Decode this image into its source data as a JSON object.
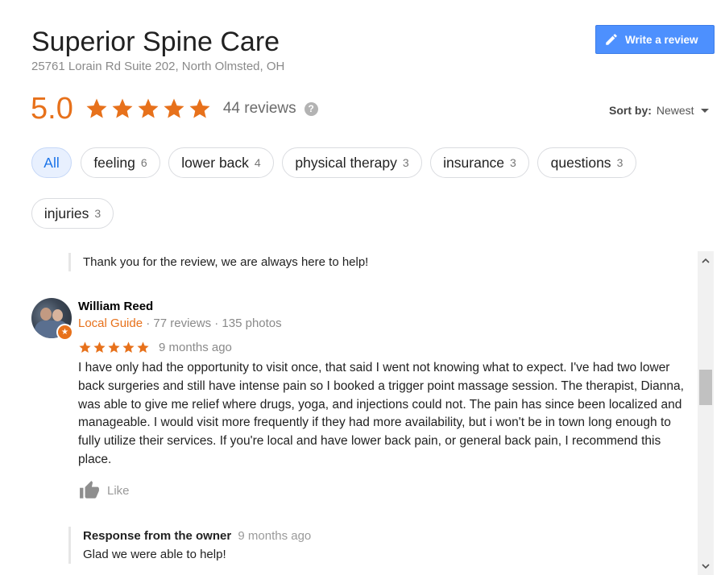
{
  "business": {
    "name": "Superior Spine Care",
    "address": "25761 Lorain Rd Suite 202, North Olmsted, OH"
  },
  "write_review": {
    "label": "Write a review",
    "icon": "pencil-icon"
  },
  "rating": {
    "score": "5.0",
    "stars": 5,
    "reviews_label": "44 reviews",
    "help_symbol": "?"
  },
  "sort": {
    "label": "Sort by:",
    "value": "Newest"
  },
  "topics": [
    {
      "label": "All",
      "count": ""
    },
    {
      "label": "feeling",
      "count": "6"
    },
    {
      "label": "lower back",
      "count": "4"
    },
    {
      "label": "physical therapy",
      "count": "3"
    },
    {
      "label": "insurance",
      "count": "3"
    },
    {
      "label": "questions",
      "count": "3"
    },
    {
      "label": "injuries",
      "count": "3"
    }
  ],
  "prev_owner_reply": {
    "text": "Thank you for the review, we are always here to help!"
  },
  "review": {
    "author": "William Reed",
    "local_guide": "Local Guide",
    "meta": " · 77 reviews · 135 photos",
    "stars": 5,
    "time": "9 months ago",
    "text": "I have only had the opportunity to visit once, that said I went not knowing what to expect. I've had two lower back surgeries and still have intense pain so I booked a trigger point massage session. The therapist, Dianna, was able to give me relief where drugs, yoga, and injections could not. The pain has since been localized and manageable. I would visit more frequently if they had more availability, but i won't be in town long enough to fully utilize their services. If you're local and have lower back pain, or general back pain, I recommend this place.",
    "like_label": "Like",
    "owner_response": {
      "title": "Response from the owner",
      "time": "9 months ago",
      "text": "Glad we were able to help!"
    }
  },
  "colors": {
    "accent_orange": "#e7711b",
    "button_blue": "#4d90fe",
    "chip_active_bg": "#e8f0fe",
    "chip_active_text": "#1a73e8"
  }
}
